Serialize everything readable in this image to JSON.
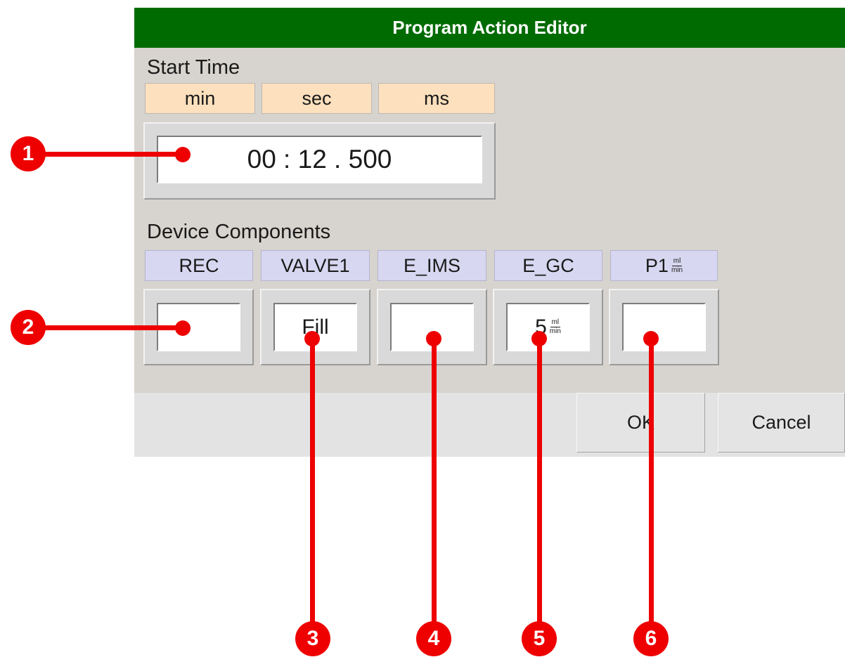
{
  "dialog": {
    "title": "Program Action Editor",
    "start_time": {
      "label": "Start Time",
      "units": [
        "min",
        "sec",
        "ms"
      ],
      "value": "00 : 12 . 500"
    },
    "device_components": {
      "label": "Device Components",
      "items": [
        {
          "name": "REC",
          "value": ""
        },
        {
          "name": "VALVE1",
          "value": "Fill"
        },
        {
          "name": "E_IMS",
          "value": ""
        },
        {
          "name": "E_GC",
          "value": "5",
          "unit_num": "ml",
          "unit_den": "min"
        },
        {
          "name": "P1",
          "value": "",
          "unit_num": "ml",
          "unit_den": "min"
        }
      ]
    },
    "buttons": {
      "ok": "OK",
      "cancel": "Cancel"
    }
  },
  "annotations": {
    "color": "#ee0000",
    "callouts": [
      "1",
      "2",
      "3",
      "4",
      "5",
      "6"
    ]
  }
}
